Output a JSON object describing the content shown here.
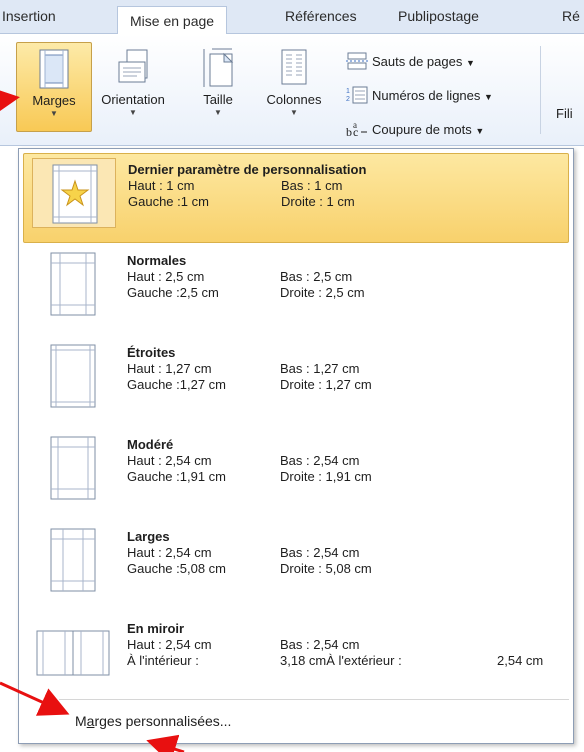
{
  "tabs": [
    {
      "label": "Insertion"
    },
    {
      "label": "Mise en page"
    },
    {
      "label": "Références"
    },
    {
      "label": "Publipostage"
    },
    {
      "label": "Ré"
    }
  ],
  "ribbon": {
    "margins_label": "Marges",
    "orientation_label": "Orientation",
    "size_label": "Taille",
    "columns_label": "Colonnes",
    "breaks_label": "Sauts de pages",
    "line_numbers_label": "Numéros de lignes",
    "hyphenation_label": "Coupure de mots",
    "cut_label": "Fili"
  },
  "gallery": [
    {
      "name": "Dernier paramètre de personnalisation",
      "r1l": "Haut :  1 cm",
      "r1r": "Bas :    1 cm",
      "r2l": "Gauche :1 cm",
      "r2r": "Droite : 1 cm",
      "icon": "star-margin-thumbnail"
    },
    {
      "name": "Normales",
      "r1l": "Haut :   2,5 cm",
      "r1r": "Bas :     2,5 cm",
      "r2l": "Gauche :2,5 cm",
      "r2r": "Droite :  2,5 cm",
      "icon": "normal-margin-thumbnail"
    },
    {
      "name": "Étroites",
      "r1l": "Haut :   1,27 cm",
      "r1r": "Bas :     1,27 cm",
      "r2l": "Gauche :1,27 cm",
      "r2r": "Droite :  1,27 cm",
      "icon": "narrow-margin-thumbnail"
    },
    {
      "name": "Modéré",
      "r1l": "Haut :   2,54 cm",
      "r1r": "Bas :     2,54 cm",
      "r2l": "Gauche :1,91 cm",
      "r2r": "Droite :  1,91 cm",
      "icon": "moderate-margin-thumbnail"
    },
    {
      "name": "Larges",
      "r1l": "Haut :   2,54 cm",
      "r1r": "Bas :     2,54 cm",
      "r2l": "Gauche :5,08 cm",
      "r2r": "Droite :  5,08 cm",
      "icon": "wide-margin-thumbnail"
    },
    {
      "name": "En miroir",
      "r1l": "Haut :   2,54 cm",
      "r1r": "Bas :     2,54 cm",
      "r2l": "À l'intérieur :",
      "r2r": "3,18 cmÀ l'extérieur :",
      "r2x": "2,54 cm",
      "icon": "mirror-margin-thumbnail"
    }
  ],
  "custom_margins": {
    "prefix": "M",
    "accel": "a",
    "rest": "rges personnalisées..."
  },
  "colors": {
    "accent": "#f8d16c",
    "annotation": "#e81010",
    "ribbon": "#dfe8f5"
  }
}
